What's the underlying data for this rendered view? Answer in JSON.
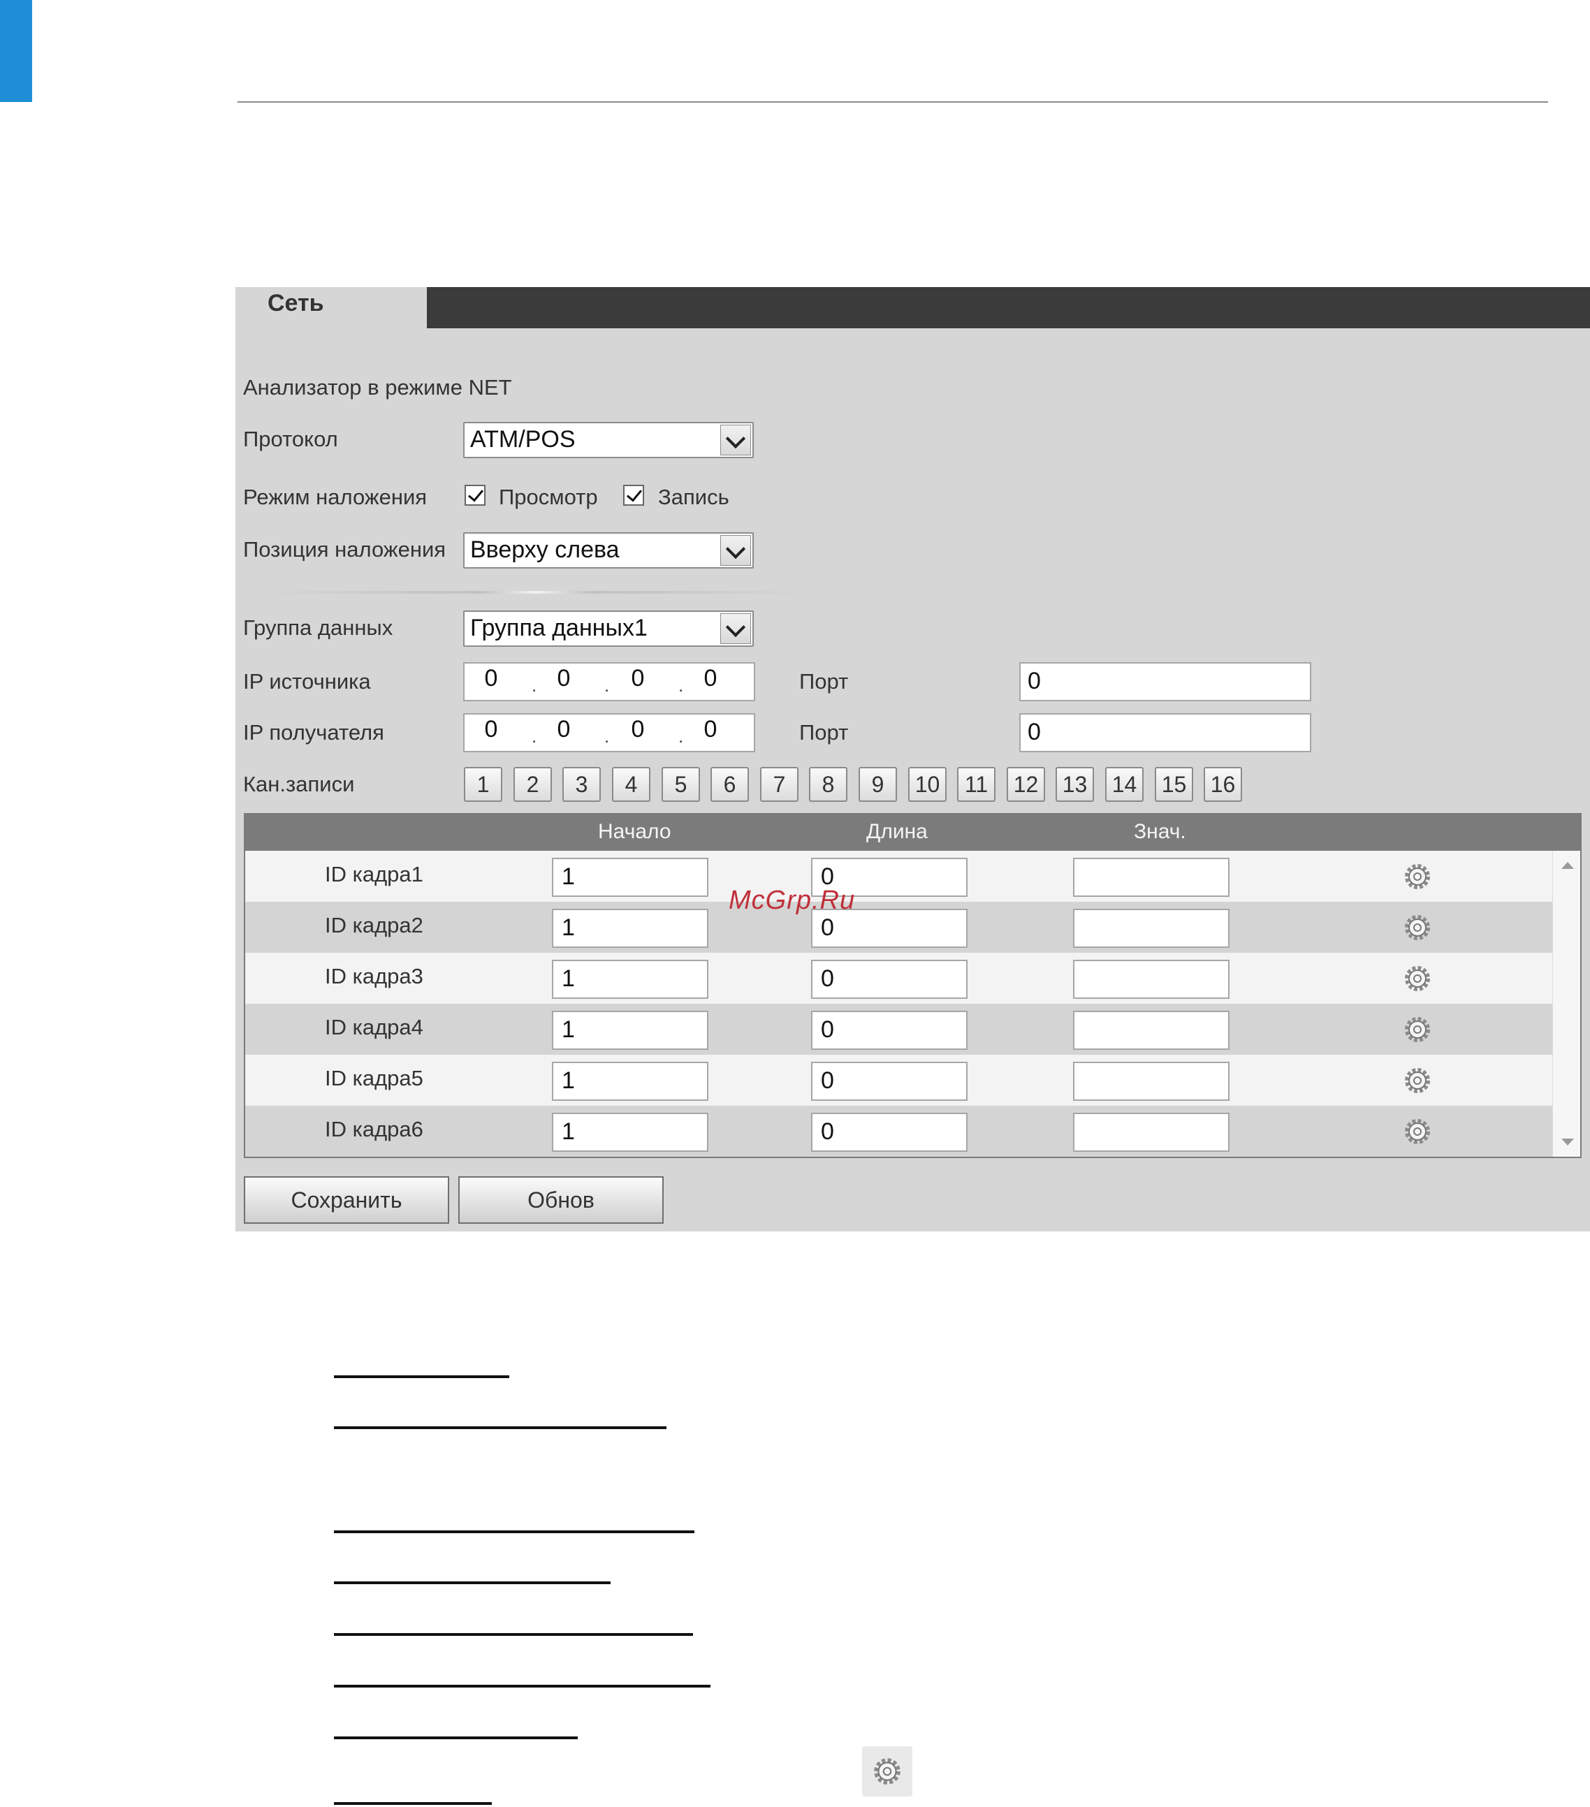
{
  "tab": {
    "label": "Сеть"
  },
  "section_title": "Анализатор в режиме NET",
  "form": {
    "protocol": {
      "label": "Протокол",
      "value": "ATM/POS"
    },
    "overlay_mode": {
      "label": "Режим наложения",
      "preview": {
        "label": "Просмотр",
        "checked": true
      },
      "record": {
        "label": "Запись",
        "checked": true
      }
    },
    "overlay_position": {
      "label": "Позиция наложения",
      "value": "Вверху слева"
    },
    "data_group": {
      "label": "Группа данных",
      "value": "Группа данных1"
    },
    "source_ip": {
      "label": "IP источника",
      "octets": [
        "0",
        "0",
        "0",
        "0"
      ],
      "port_label": "Порт",
      "port": "0"
    },
    "dest_ip": {
      "label": "IP получателя",
      "octets": [
        "0",
        "0",
        "0",
        "0"
      ],
      "port_label": "Порт",
      "port": "0"
    },
    "record_channels": {
      "label": "Кан.записи",
      "channels": [
        "1",
        "2",
        "3",
        "4",
        "5",
        "6",
        "7",
        "8",
        "9",
        "10",
        "11",
        "12",
        "13",
        "14",
        "15",
        "16"
      ]
    }
  },
  "grid": {
    "headers": {
      "start": "Начало",
      "length": "Длина",
      "value": "Знач."
    },
    "rows": [
      {
        "label": "ID кадра1",
        "start": "1",
        "length": "0",
        "value": ""
      },
      {
        "label": "ID кадра2",
        "start": "1",
        "length": "0",
        "value": ""
      },
      {
        "label": "ID кадра3",
        "start": "1",
        "length": "0",
        "value": ""
      },
      {
        "label": "ID кадра4",
        "start": "1",
        "length": "0",
        "value": ""
      },
      {
        "label": "ID кадра5",
        "start": "1",
        "length": "0",
        "value": ""
      },
      {
        "label": "ID кадра6",
        "start": "1",
        "length": "0",
        "value": ""
      }
    ]
  },
  "buttons": {
    "save": "Сохранить",
    "refresh": "Обнов"
  },
  "watermark": "McGrp.Ru",
  "icons": {
    "settings": "gear-icon",
    "dropdown": "chevron-down-icon",
    "check": "check-icon"
  },
  "colors": {
    "accent_blue": "#1e8fd6",
    "tabbar": "#3b3b3b",
    "panel": "#d6d6d6",
    "grid_header": "#7b7b7b",
    "watermark": "#c0303a"
  }
}
